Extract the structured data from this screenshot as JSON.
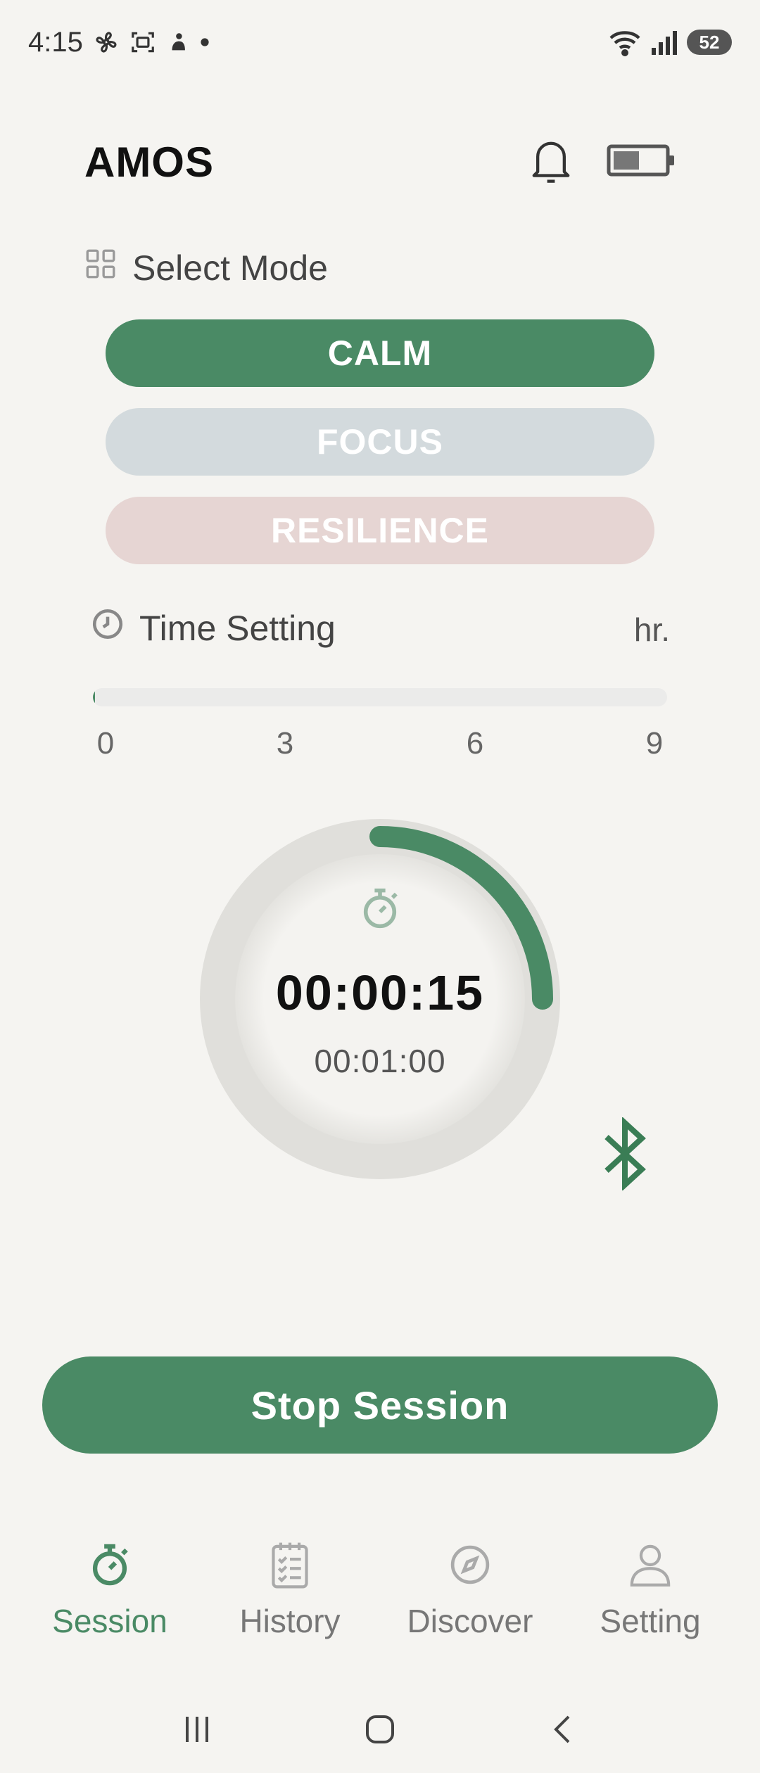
{
  "status_bar": {
    "time": "4:15",
    "battery": "52"
  },
  "header": {
    "title": "AMOS"
  },
  "mode_section": {
    "label": "Select Mode",
    "modes": [
      {
        "label": "CALM",
        "selected": true
      },
      {
        "label": "FOCUS",
        "selected": false
      },
      {
        "label": "RESILIENCE",
        "selected": false
      }
    ]
  },
  "time_setting": {
    "label": "Time Setting",
    "unit": "hr.",
    "ticks": [
      "0",
      "3",
      "6",
      "9"
    ],
    "value_fraction": 0.003
  },
  "timer": {
    "elapsed": "00:00:15",
    "total": "00:01:00",
    "progress_fraction": 0.25
  },
  "stop_button": {
    "label": "Stop Session"
  },
  "bottom_nav": {
    "items": [
      {
        "label": "Session",
        "icon": "stopwatch-icon",
        "active": true
      },
      {
        "label": "History",
        "icon": "notepad-icon",
        "active": false
      },
      {
        "label": "Discover",
        "icon": "compass-icon",
        "active": false
      },
      {
        "label": "Setting",
        "icon": "person-icon",
        "active": false
      }
    ]
  },
  "colors": {
    "accent": "#4a8a65",
    "background": "#f5f4f1",
    "focus_mode": "#d3dadd",
    "resilience_mode": "#e6d5d3"
  }
}
